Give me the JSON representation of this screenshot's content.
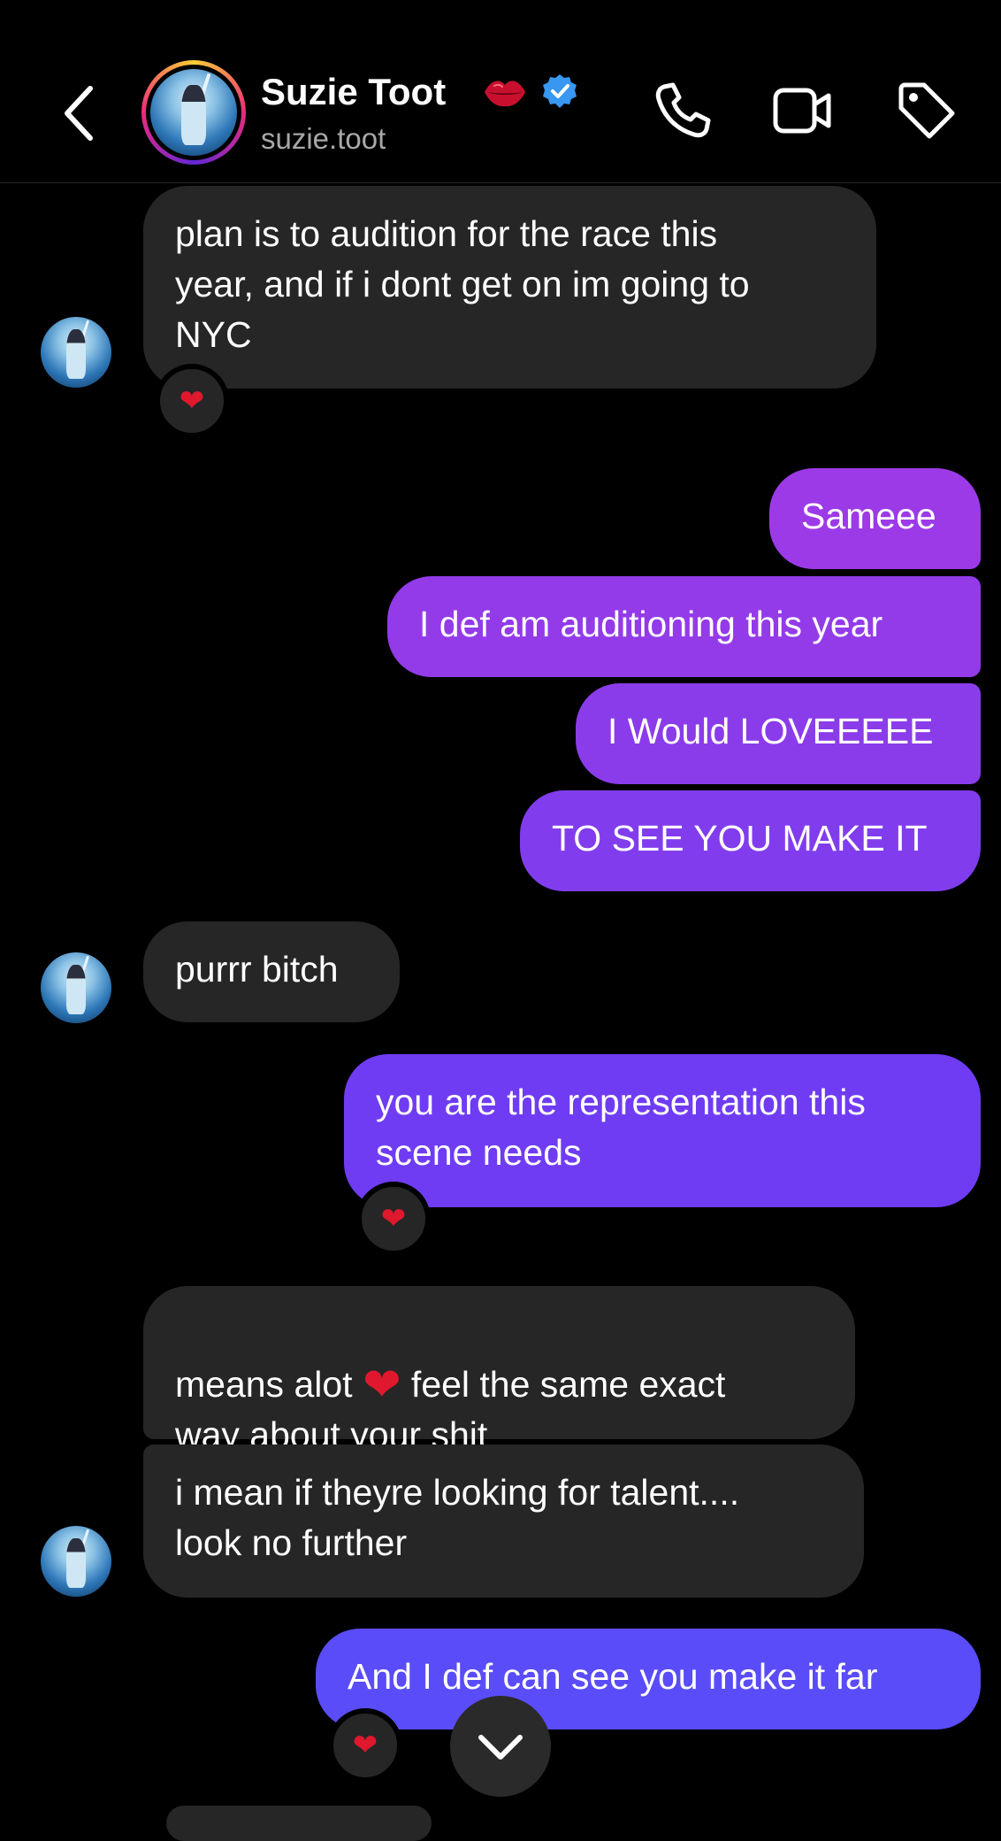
{
  "header": {
    "name": "Suzie Toot",
    "username": "suzie.toot",
    "icons": [
      "back-icon",
      "lips-emoji-icon",
      "verified-badge-icon",
      "phone-icon",
      "video-icon",
      "tag-icon"
    ]
  },
  "colors": {
    "background": "#000000",
    "received_bubble": "#262626",
    "sent_gradient_top": "#9b3ae8",
    "sent_gradient_bottom": "#5a4cf8",
    "heart": "#e0182d",
    "muted_text": "#a8a8a8"
  },
  "messages": [
    {
      "from": "them",
      "text": "plan is to audition for the race this\nyear, and if i dont get on im going to\nNYC",
      "reaction": "❤"
    },
    {
      "from": "me",
      "text": "Sameee"
    },
    {
      "from": "me",
      "text": "I def am auditioning this year"
    },
    {
      "from": "me",
      "text": "I Would LOVEEEEE"
    },
    {
      "from": "me",
      "text": "TO SEE YOU MAKE IT"
    },
    {
      "from": "them",
      "text": "purrr bitch"
    },
    {
      "from": "me",
      "text": "you are the representation this\nscene needs",
      "reaction": "❤"
    },
    {
      "from": "them",
      "text_before": "means alot ",
      "emoji": "❤",
      "text_after": " feel the same exact\nway about your shit"
    },
    {
      "from": "them",
      "text": "i mean if theyre looking for talent....\nlook no further"
    },
    {
      "from": "me",
      "text": "And I def can see you make it far",
      "reaction": "❤"
    }
  ]
}
